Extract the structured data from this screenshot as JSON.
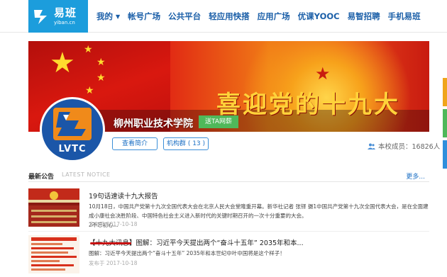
{
  "logo": {
    "name_cn": "易班",
    "domain": "yiban.cn"
  },
  "nav": {
    "items": [
      "我的",
      "帐号广场",
      "公共平台",
      "轻应用快搭",
      "应用广场",
      "优课YOOC",
      "易智招聘",
      "手机易班"
    ]
  },
  "banner": {
    "title": "喜迎党的十九大"
  },
  "profile": {
    "avatar_text": "LVTC",
    "name": "柳州职业技术学院",
    "send_label": "送TA网薪",
    "intro_label": "查看简介",
    "group_label": "机构群 ( 13 )",
    "followers_label": "本校成员：16826人"
  },
  "notice": {
    "title_cn": "最新公告",
    "title_en": "LATEST NOTICE",
    "more": "更多..."
  },
  "news": [
    {
      "title": "19句话速读十九大报告",
      "body": "10月18日，中国共产党第十九次全国代表大会在北京人民大会堂隆重开幕。新华社记者 张铎 摄1中国共产党第十九次全国代表大会，是在全面建成小康社会决胜阶段、中国特色社会主义进入新时代的关键时期召开的一次十分重要的大会。　　　　　　　　　　　　　　　　　　　　　　　　　　　　2不忘初心...",
      "date": "发布于 2017-10-18"
    },
    {
      "title": "【十九大讯息】图解：习近平今天提出两个“奋斗十五年” 2035年和本...",
      "body": "图解：习近平今天提出两个“奋斗十五年” 2035年和本世纪中叶中国将是这个样子！",
      "date": "发布于 2017-10-18"
    }
  ],
  "colors": {
    "brand_blue": "#1c9ddc",
    "nav_text": "#1b5fa8",
    "send_green": "#4fb85a",
    "banner_red": "#d9180f",
    "banner_gold": "#ffd23a"
  },
  "icons": [
    "yiban-logo-icon",
    "chevron-down-icon",
    "users-icon",
    "star-icon"
  ]
}
